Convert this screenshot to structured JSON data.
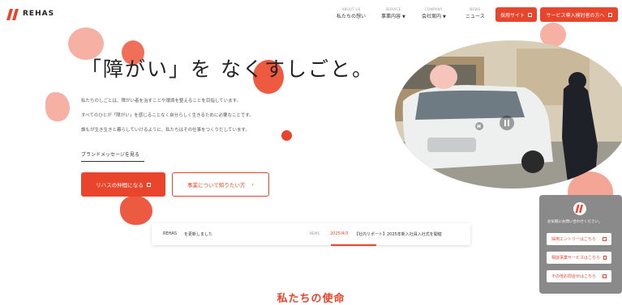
{
  "logo": {
    "text": "REHAS"
  },
  "nav": [
    {
      "en": "ABOUT US",
      "label": "私たちの想い",
      "dropdown": false
    },
    {
      "en": "SERVICE",
      "label": "事業内容",
      "dropdown": true
    },
    {
      "en": "COMPANY",
      "label": "会社案内",
      "dropdown": true
    },
    {
      "en": "NEWS",
      "label": "ニュース",
      "dropdown": false
    }
  ],
  "header_buttons": {
    "recruit": "採用サイト",
    "service": "サービス導入検討者の方へ"
  },
  "hero": {
    "title": "「障がい」を なくすしごと。",
    "lines": [
      "私たちのしごとは、障がい者を治すことや環境を整えることを目指しています。",
      "すべてのひとが「障がい」を感じることなく自分らしく生きるために必要なことです。",
      "誰もが生き生きと暮らしていけるように、私たちはその仕事をつくりだしています。"
    ],
    "brand_link": "ブランドメッセージを見る",
    "cta_primary": "リハスの仲間になる",
    "cta_secondary": "事業について知りたい方",
    "chevron": "›"
  },
  "video": {
    "play_icon": "play-icon",
    "pause_icon": "pause-icon"
  },
  "news": {
    "left_tag": "REHAS",
    "left_text": "を更新しました",
    "label": "NEWS",
    "date": "2025/4/3",
    "title": "【社内リポート】2025年新入社員入社式を開催"
  },
  "side_panel": {
    "heading": "お気軽にお問い合わせください。",
    "buttons": [
      "採用エントリーはこちら",
      "相談事業サービスはこちら",
      "その他お問合せはこちら"
    ]
  },
  "section": {
    "title": "私たちの使命"
  },
  "colors": {
    "accent": "#e9452c",
    "blob": "#f4a596"
  }
}
